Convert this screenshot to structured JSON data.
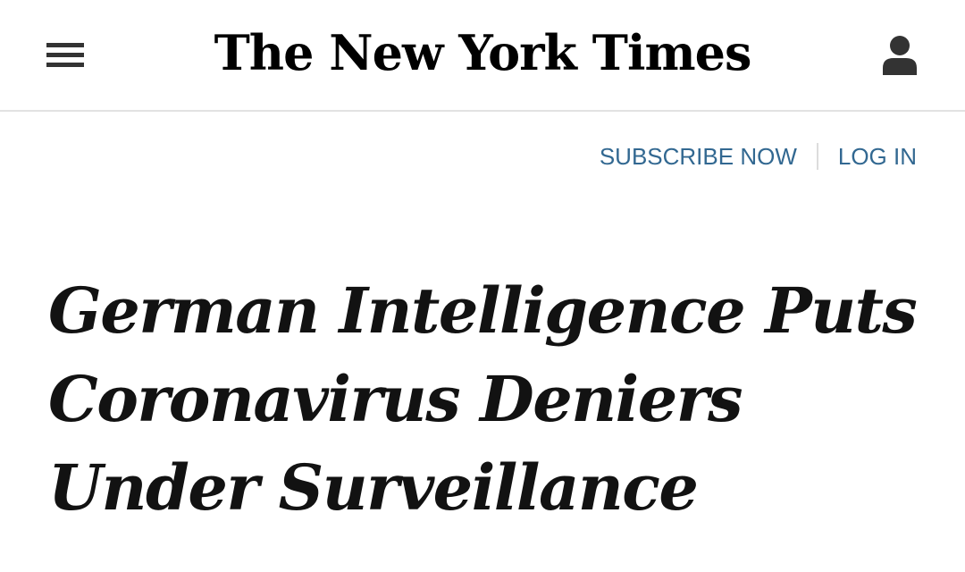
{
  "masthead": {
    "logo_text": "The New York Times",
    "menu_icon": "hamburger-menu-icon",
    "account_icon": "user-account-icon"
  },
  "auth": {
    "subscribe_label": "SUBSCRIBE NOW",
    "login_label": "LOG IN"
  },
  "article": {
    "headline": "German Intelligence Puts Coronavirus Deniers Under Surveillance"
  },
  "colors": {
    "link": "#326891",
    "text": "#121212",
    "rule": "#e2e2e2"
  }
}
